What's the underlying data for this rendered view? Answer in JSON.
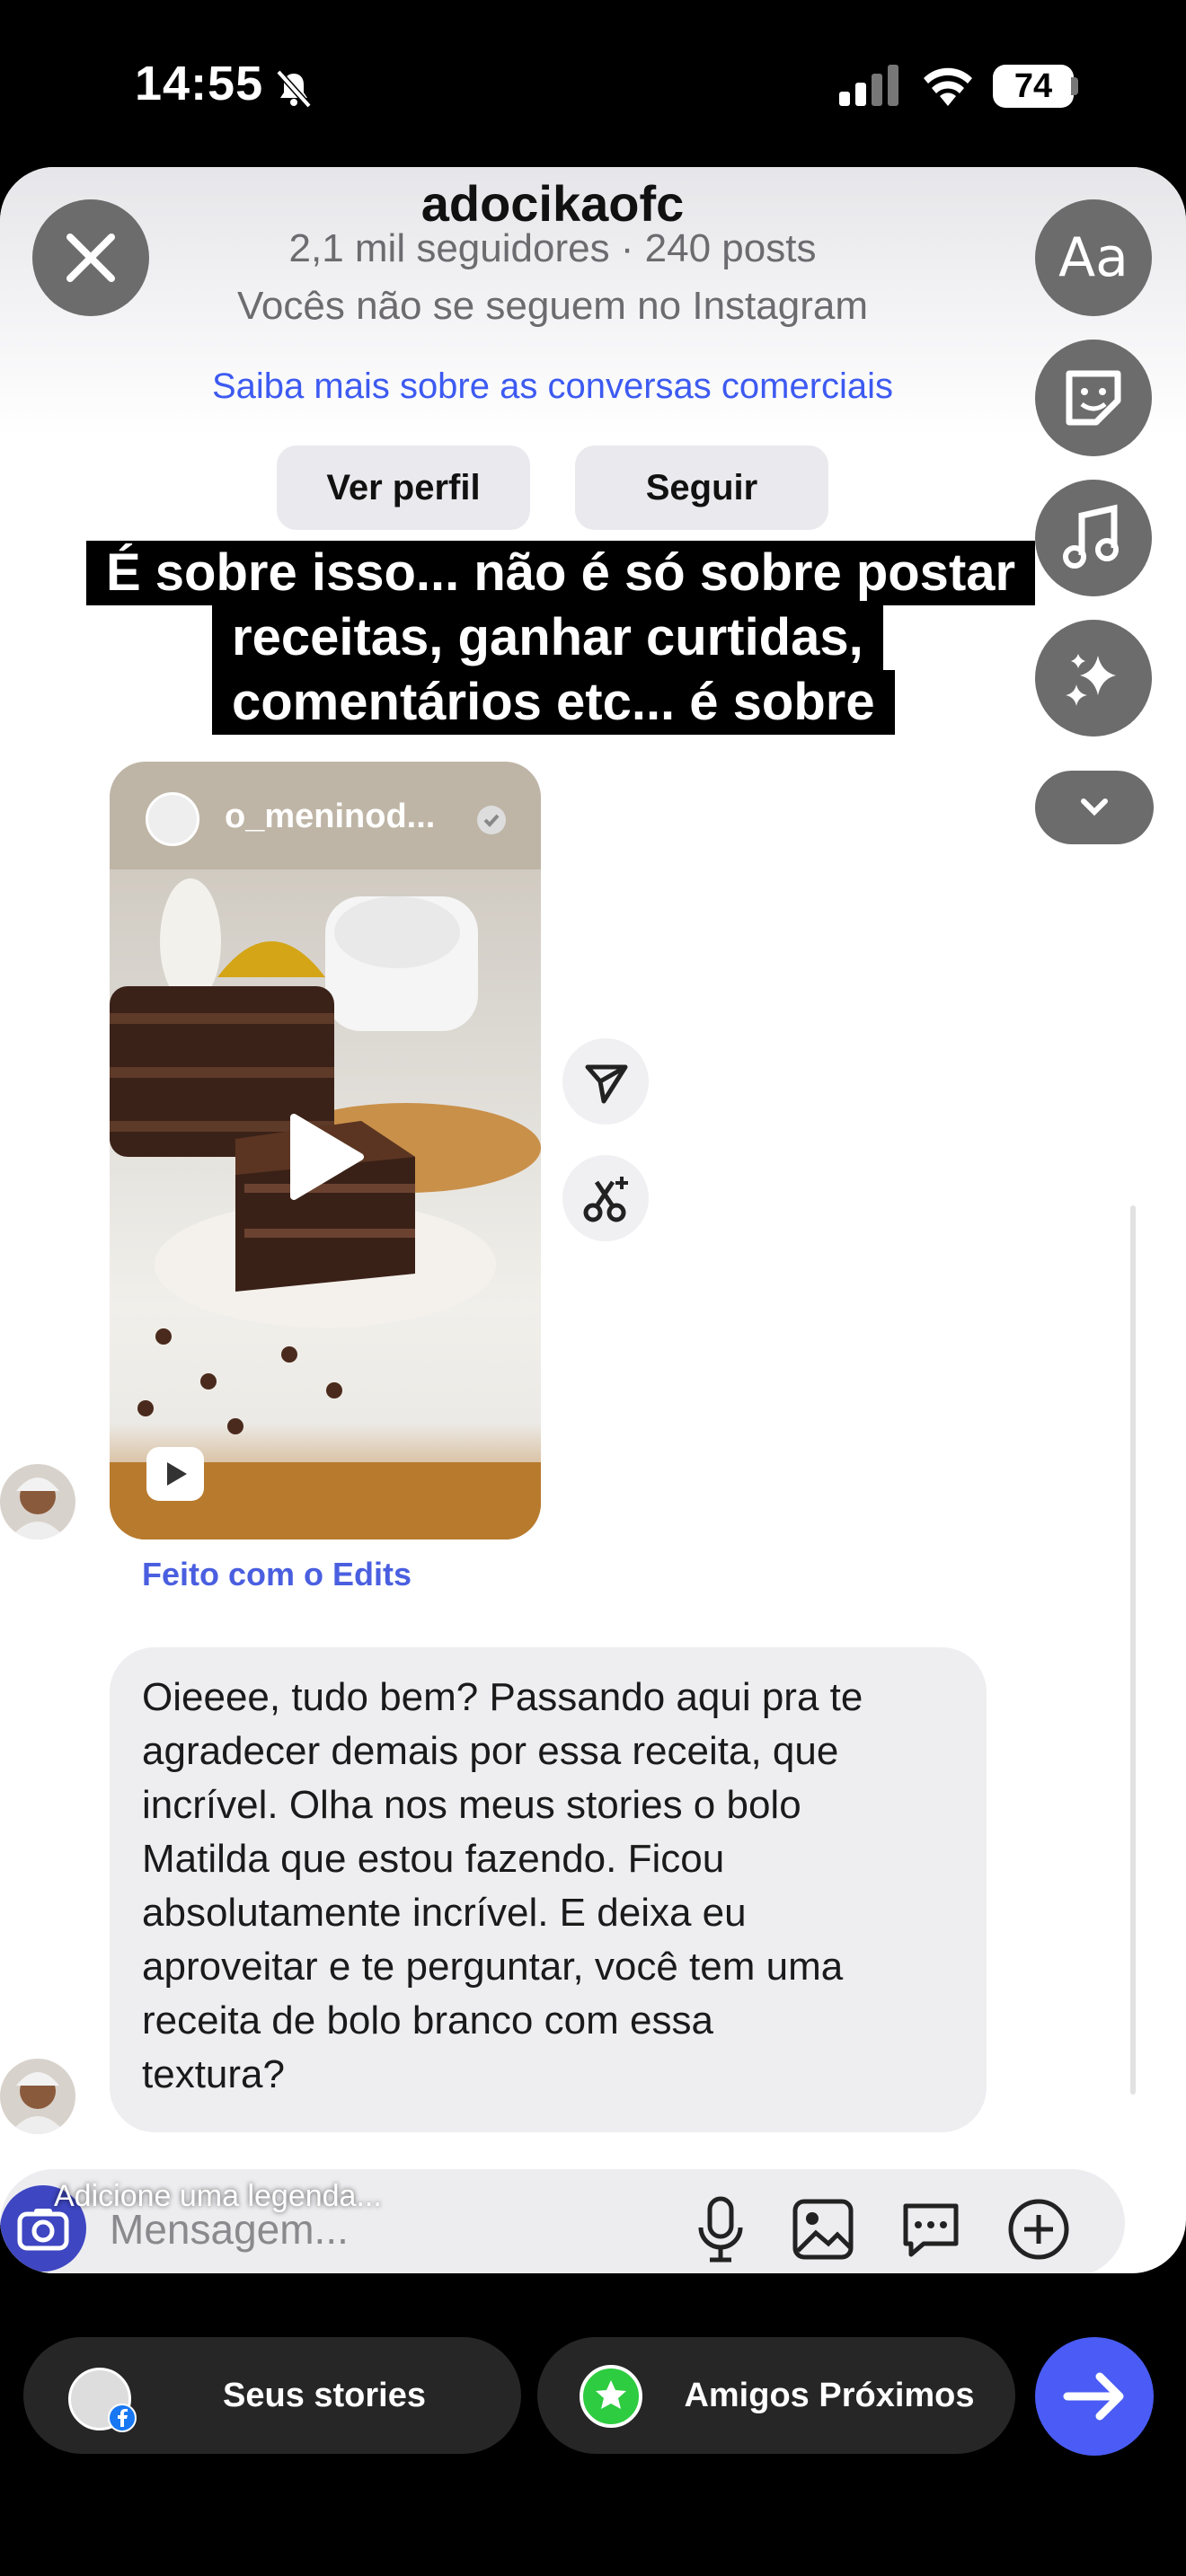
{
  "status": {
    "time": "14:55",
    "battery": "74"
  },
  "profile": {
    "username": "adocikaofc",
    "followers": "2,1 mil seguidores · 240 posts",
    "relationship": "Vocês não se seguem no Instagram",
    "business_link": "Saiba mais sobre as conversas comerciais",
    "view_profile": "Ver perfil",
    "follow": "Seguir"
  },
  "tools": {
    "text_tool": "Aa"
  },
  "caption": {
    "line1": "É sobre isso... não é só sobre postar",
    "line2": "receitas, ganhar curtidas,",
    "line3": "comentários etc... é sobre"
  },
  "shared_post": {
    "author": "o_meninod...",
    "made_with": "Feito com o Edits"
  },
  "message": {
    "lines": [
      "Oieeee, tudo bem?  Passando aqui pra te",
      "agradecer demais por essa receita, que",
      "incrível. Olha nos meus stories o bolo",
      "Matilda que estou fazendo. Ficou",
      "absolutamente incrível. E deixa eu",
      "aproveitar e te perguntar, você tem uma",
      "receita de bolo branco com essa",
      "textura?"
    ]
  },
  "compose": {
    "caption_placeholder": "Adicione uma legenda...",
    "message_placeholder": "Mensagem..."
  },
  "share": {
    "your_stories": "Seus stories",
    "close_friends": "Amigos Próximos"
  },
  "colors": {
    "accent": "#4a5cf5",
    "link": "#3d5af1",
    "close_friends": "#2ecc40"
  }
}
